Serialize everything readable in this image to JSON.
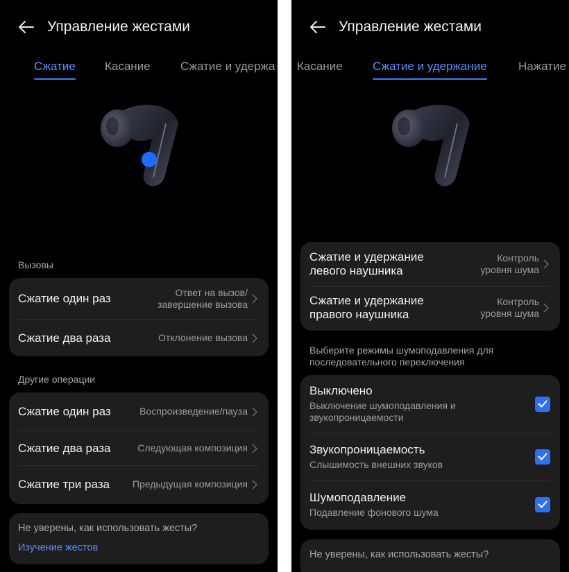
{
  "left": {
    "title": "Управление жестами",
    "tabs": [
      "Сжатие",
      "Касание",
      "Сжатие и удержа"
    ],
    "calls": {
      "label": "Вызовы",
      "items": [
        {
          "title": "Сжатие один раз",
          "value_line1": "Ответ на вызов/",
          "value_line2": "завершение вызова"
        },
        {
          "title": "Сжатие два раза",
          "value_line1": "Отклонение вызова"
        }
      ]
    },
    "other": {
      "label": "Другие операции",
      "items": [
        {
          "title": "Сжатие один раз",
          "value": "Воспроизведение/пауза"
        },
        {
          "title": "Сжатие два раза",
          "value": "Следующая композиция"
        },
        {
          "title": "Сжатие три раза",
          "value": "Предыдущая композиция"
        }
      ]
    },
    "help": {
      "question": "Не уверены, как использовать жесты?",
      "link": "Изучение жестов"
    }
  },
  "right": {
    "title": "Управление жестами",
    "tabs": [
      "Касание",
      "Сжатие и удержание",
      "Нажатие"
    ],
    "hold": [
      {
        "title_line1": "Сжатие и удержание",
        "title_line2": "левого наушника",
        "value_line1": "Контроль",
        "value_line2": "уровня шума"
      },
      {
        "title_line1": "Сжатие и удержание",
        "title_line2": "правого наушника",
        "value_line1": "Контроль",
        "value_line2": "уровня шума"
      }
    ],
    "modes_label_line1": "Выберите режимы шумоподавления для",
    "modes_label_line2": "последовательного переключения",
    "modes": [
      {
        "title": "Выключено",
        "sub_line1": "Выключение шумоподавления и",
        "sub_line2": "звукопроницаемости",
        "checked": true
      },
      {
        "title": "Звукопроницаемость",
        "sub_line1": "Слышимость внешних звуков",
        "checked": true
      },
      {
        "title": "Шумоподавление",
        "sub_line1": "Подавление фонового шума",
        "checked": true
      }
    ],
    "help": {
      "question": "Не уверены, как использовать жесты?"
    }
  },
  "colors": {
    "accent": "#5a8dff",
    "checkbox": "#2f6ff0",
    "card": "#1e1e1e",
    "background": "#000000"
  }
}
